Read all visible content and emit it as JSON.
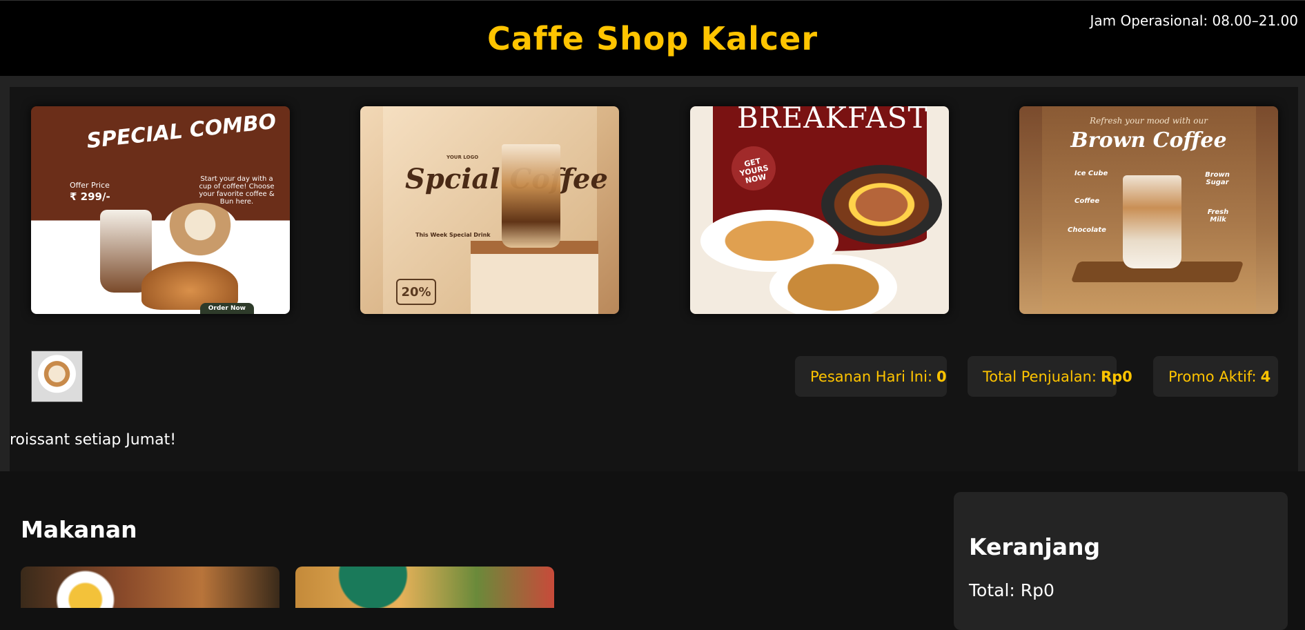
{
  "header": {
    "title": "Caffe Shop Kalcer"
  },
  "hero": {
    "hours": "Jam Operasional: 08.00–21.00",
    "banners": [
      {
        "title": "SPECIAL COMBO",
        "offer_label": "Offer Price",
        "price": "₹ 299/-",
        "description": "Start your day with a cup of coffee! Choose your favorite coffee & Bun here.",
        "cta": "Order Now"
      },
      {
        "logo": "YOUR LOGO",
        "title": "Spcial Coffee",
        "subtitle": "This Week Special Drink",
        "discount": "20%"
      },
      {
        "title": "BREAKFAST",
        "badge": "GET YOURS NOW"
      },
      {
        "subtitle": "Refresh your mood with our",
        "title": "Brown Coffee",
        "labels": [
          "Ice Cube",
          "Coffee",
          "Chocolate",
          "Brown Sugar",
          "Fresh Milk"
        ]
      }
    ],
    "stats": [
      {
        "label": "Pesanan Hari Ini:",
        "value": "0"
      },
      {
        "label": "Total Penjualan:",
        "value": "Rp0"
      },
      {
        "label": "Promo Aktif:",
        "value": "4"
      }
    ],
    "ticker": "roissant setiap Jumat!"
  },
  "menu": {
    "section_title": "Makanan"
  },
  "cart": {
    "title": "Keranjang",
    "total": "Total: Rp0"
  },
  "colors": {
    "accent": "#ffc400",
    "background": "#111111",
    "header_bg": "#000000",
    "card_bg": "#242424"
  }
}
